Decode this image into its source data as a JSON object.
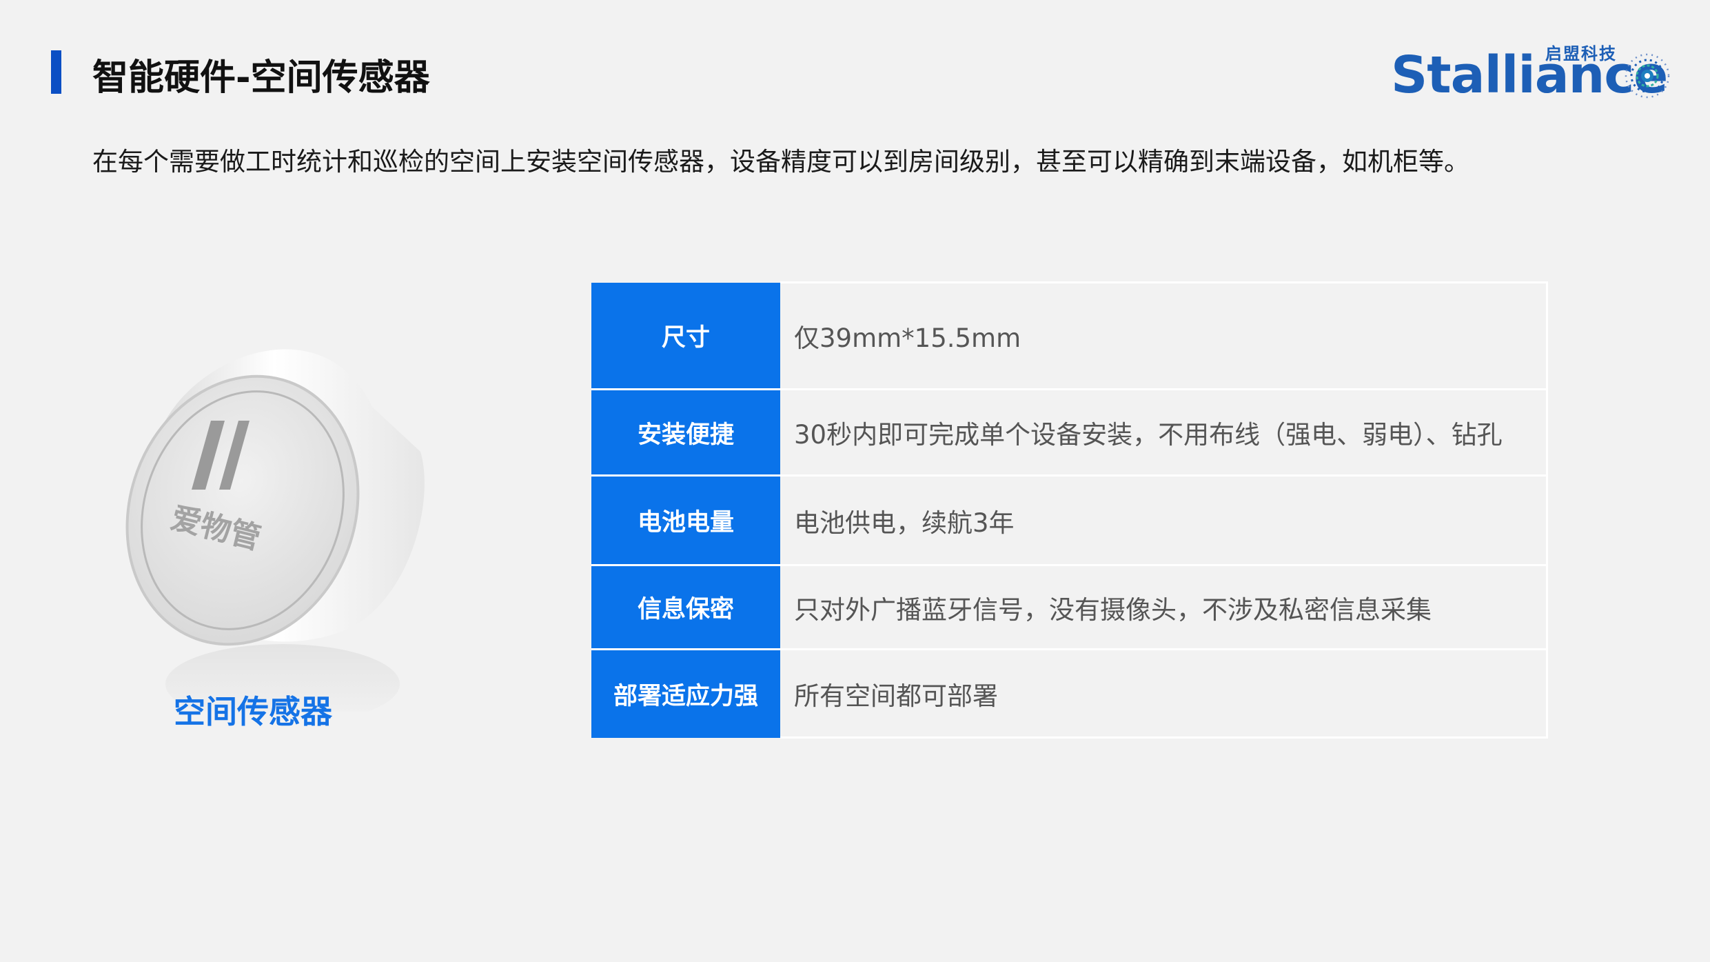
{
  "header": {
    "title": "智能硬件-空间传感器"
  },
  "logo": {
    "wordmark": "Stalliance",
    "chinese_name": "启盟科技",
    "icon": "circuit-globe-icon"
  },
  "intro": {
    "text": "在每个需要做工时统计和巡检的空间上安装空间传感器，设备精度可以到房间级别，甚至可以精确到末端设备，如机柜等。"
  },
  "product": {
    "device_brand_text": "爱物管",
    "caption": "空间传感器"
  },
  "specs": [
    {
      "label": "尺寸",
      "value": "仅39mm*15.5mm"
    },
    {
      "label": "安装便捷",
      "value": "30秒内即可完成单个设备安装，不用布线（强电、弱电）、钻孔"
    },
    {
      "label": "电池电量",
      "value": "电池供电，续航3年"
    },
    {
      "label": "信息保密",
      "value": "只对外广播蓝牙信号，没有摄像头，不涉及私密信息采集"
    },
    {
      "label": "部署适应力强",
      "value": "所有空间都可部署"
    }
  ],
  "colors": {
    "accent_blue": "#0a73ea",
    "title_bar": "#0b4fc4",
    "caption_blue": "#1573e6",
    "logo_blue": "#1d5fb6"
  }
}
